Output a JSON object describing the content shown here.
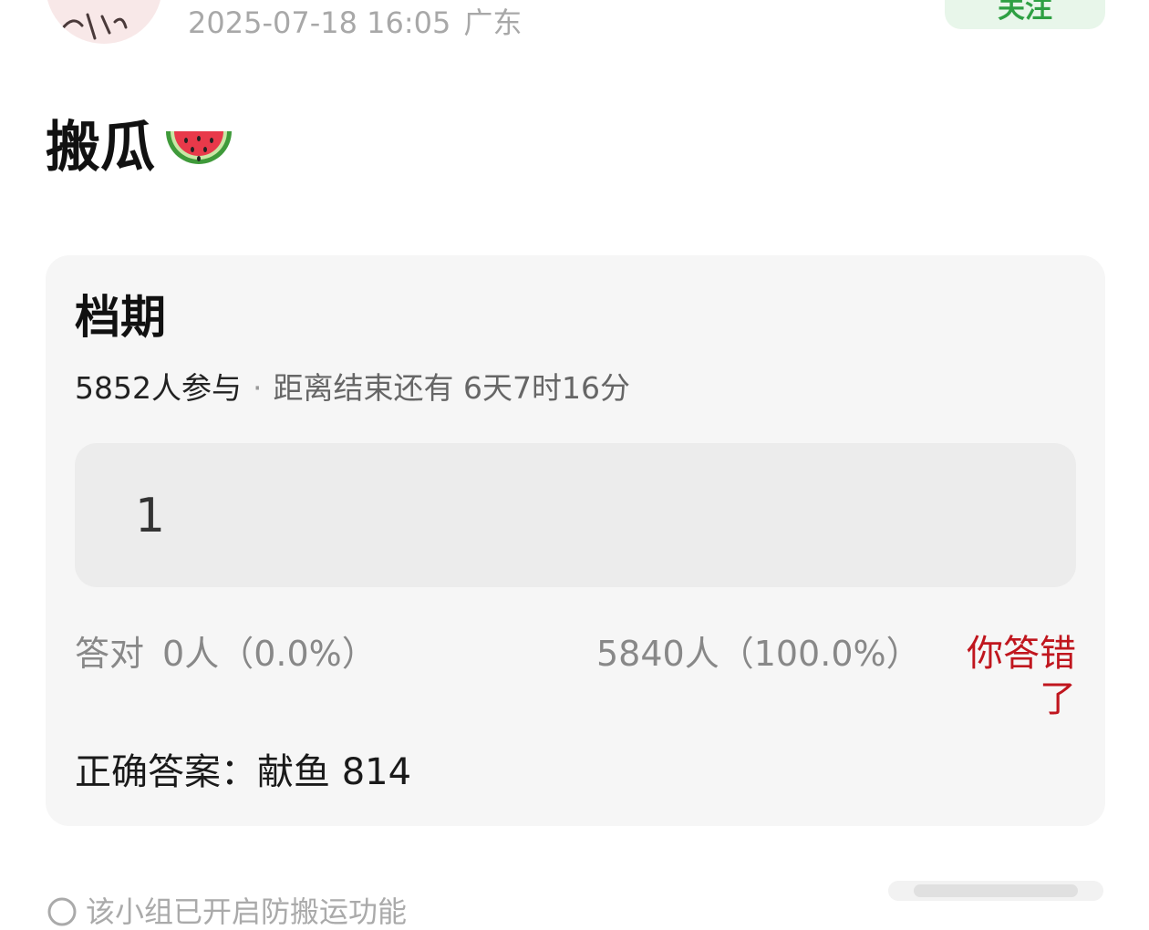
{
  "header": {
    "timestamp": "2025-07-18 16:05",
    "location": "广东",
    "follow_label": "关注",
    "avatar_icon": "avatar-icon"
  },
  "post": {
    "title": "搬瓜",
    "emoji_icon": "watermelon-icon"
  },
  "quiz": {
    "title": "档期",
    "participants": "5852人参与",
    "separator": "·",
    "remaining": "距离结束还有 6天7时16分",
    "option_value": "1",
    "correct_label": "答对",
    "correct_stats": "0人（0.0%）",
    "wrong_stats": "5840人（100.0%）",
    "wrong_message": "你答错了",
    "answer": "正确答案：献鱼 814",
    "wrong_color": "#c0161e"
  },
  "footer": {
    "notice": "该小组已开启防搬运功能",
    "notice_icon": "info-icon"
  }
}
